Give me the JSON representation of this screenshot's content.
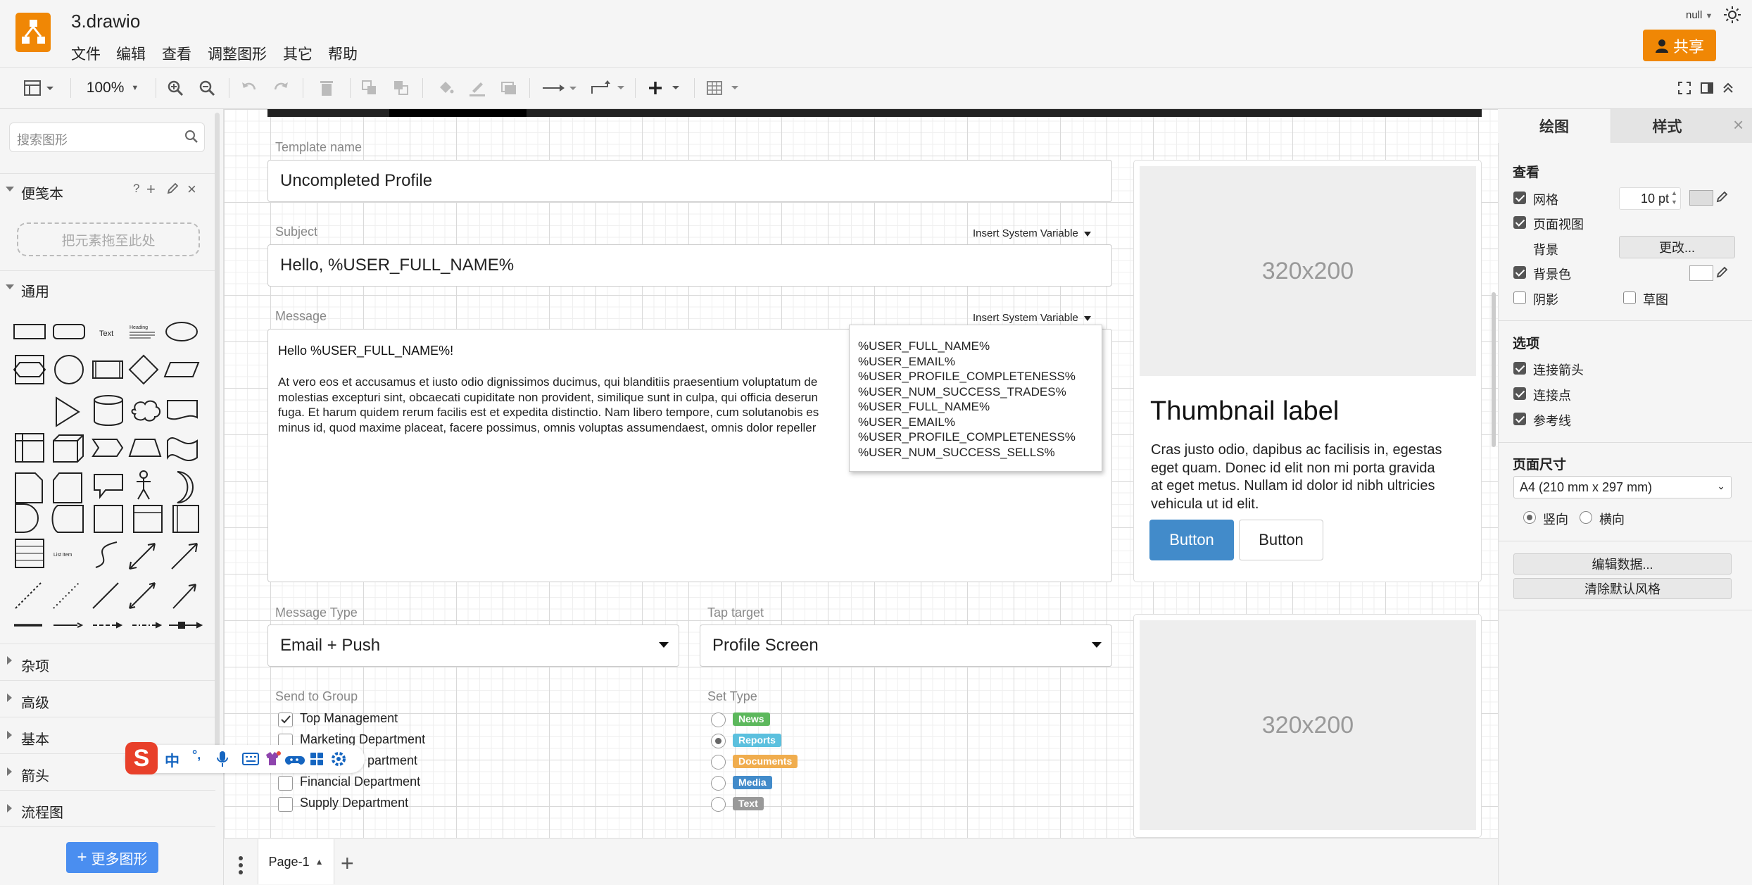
{
  "header": {
    "file_title": "3.drawio",
    "menus": [
      "文件",
      "编辑",
      "查看",
      "调整图形",
      "其它",
      "帮助"
    ],
    "user": "null",
    "share_label": "共享"
  },
  "toolbar": {
    "zoom": "100%"
  },
  "left_panel": {
    "search_placeholder": "搜索图形",
    "scratchpad": "便笺本",
    "scratchpad_help": "?",
    "drop_hint": "把元素拖至此处",
    "general": "通用",
    "shape_text": "Text",
    "shape_heading": "Heading",
    "shape_list_item": "List Item",
    "sections": [
      "杂项",
      "高级",
      "基本",
      "箭头",
      "流程图"
    ],
    "more_shapes": "更多图形"
  },
  "ime_toolbar": {
    "lang": "中",
    "punct": "°,"
  },
  "form": {
    "template_name_label": "Template name",
    "template_name_value": "Uncompleted Profile",
    "subject_label": "Subject",
    "insert_var_label": "Insert System Variable",
    "subject_value": "Hello, %USER_FULL_NAME%",
    "message_label": "Message",
    "message_greeting": "Hello %USER_FULL_NAME%!",
    "message_body": [
      "At vero eos et accusamus et iusto odio dignissimos ducimus, qui blanditiis praesentium voluptatum de",
      "molestias excepturi sint, obcaecati cupiditate non provident, similique sunt in culpa, qui officia deserun",
      "fuga. Et harum quidem rerum facilis est et expedita distinctio. Nam libero tempore, cum solutanobis es",
      "minus id, quod maxime placeat, facere possimus, omnis voluptas assumendaest, omnis dolor repeller"
    ],
    "variables": [
      "%USER_FULL_NAME%",
      "%USER_EMAIL%",
      "%USER_PROFILE_COMPLETENESS%",
      "%USER_NUM_SUCCESS_TRADES%",
      "%USER_FULL_NAME%",
      "%USER_EMAIL%",
      "%USER_PROFILE_COMPLETENESS%",
      "%USER_NUM_SUCCESS_SELLS%"
    ],
    "message_type_label": "Message Type",
    "message_type_value": "Email + Push",
    "tap_target_label": "Tap target",
    "tap_target_value": "Profile Screen",
    "send_to_group_label": "Send to Group",
    "groups": [
      {
        "label": "Top Management",
        "checked": true
      },
      {
        "label": "Marketing Department",
        "checked": false
      },
      {
        "label": "partment",
        "checked": false
      },
      {
        "label": "Financial Department",
        "checked": false
      },
      {
        "label": "Supply Department",
        "checked": false
      }
    ],
    "set_type_label": "Set Type",
    "types": [
      {
        "label": "News",
        "color": "#5cb85c",
        "selected": false
      },
      {
        "label": "Reports",
        "color": "#5bc0de",
        "selected": true
      },
      {
        "label": "Documents",
        "color": "#f0ad4e",
        "selected": false
      },
      {
        "label": "Media",
        "color": "#428bca",
        "selected": false
      },
      {
        "label": "Text",
        "color": "#999999",
        "selected": false
      }
    ]
  },
  "cards": [
    {
      "image_text": "320x200",
      "title": "Thumbnail label",
      "body": [
        "Cras justo odio, dapibus ac facilisis in, egestas",
        "eget quam. Donec id elit non mi porta gravida",
        "at eget metus. Nullam id dolor id nibh ultricies",
        "vehicula ut id elit."
      ],
      "primary_button": "Button",
      "secondary_button": "Button"
    },
    {
      "image_text": "320x200"
    }
  ],
  "right_panel": {
    "tabs": [
      "绘图",
      "样式"
    ],
    "view_heading": "查看",
    "grid_label": "网格",
    "grid_size": "10 pt",
    "page_view_label": "页面视图",
    "background_label": "背景",
    "change_button": "更改...",
    "background_color_label": "背景色",
    "shadow_label": "阴影",
    "sketch_label": "草图",
    "options_heading": "选项",
    "connection_arrows_label": "连接箭头",
    "connection_points_label": "连接点",
    "guides_label": "参考线",
    "page_size_heading": "页面尺寸",
    "page_size_value": "A4 (210 mm x 297 mm)",
    "portrait_label": "竖向",
    "landscape_label": "横向",
    "edit_data_button": "编辑数据...",
    "clear_style_button": "清除默认风格"
  },
  "bottom": {
    "page_tab": "Page-1"
  },
  "colors": {
    "accent": "#f08705",
    "primary_button": "#428bca",
    "more_shapes_button": "#4a8ef0"
  }
}
